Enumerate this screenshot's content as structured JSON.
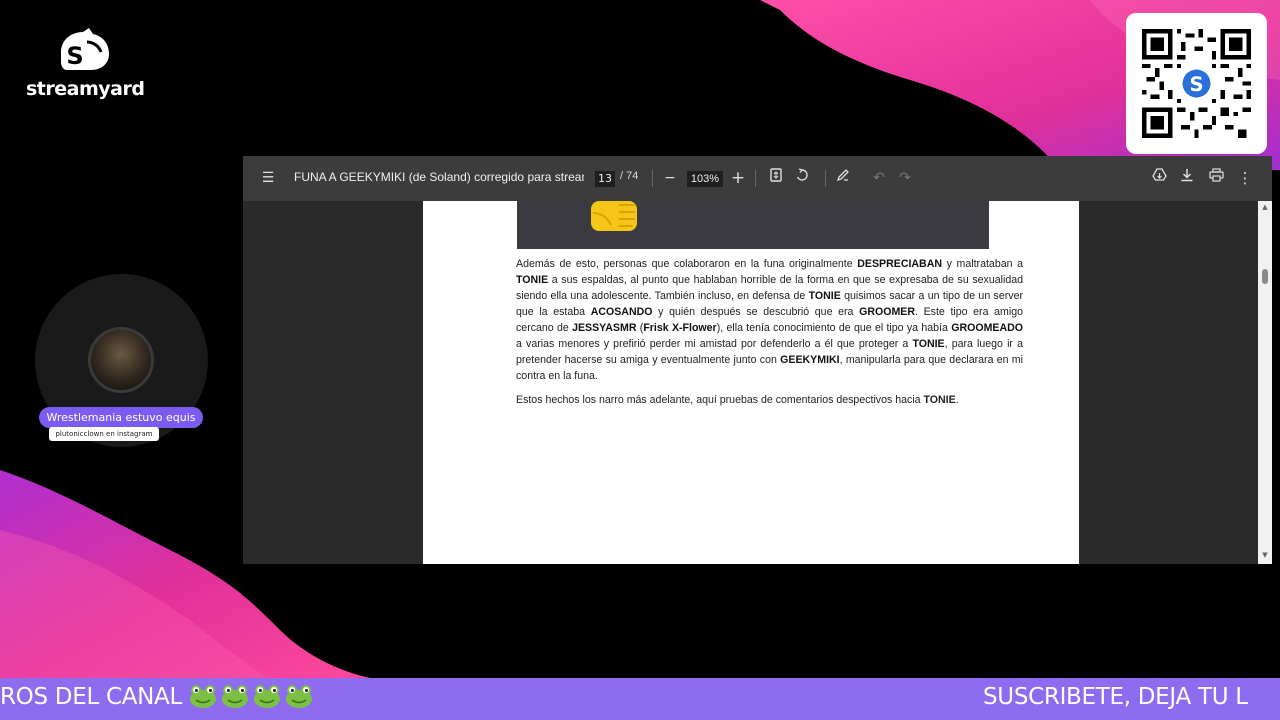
{
  "brand": {
    "wordmark": "streamyard"
  },
  "qr": {
    "icon": "qr-code-icon"
  },
  "participant": {
    "name": "Wrestlemania estuvo equis",
    "subtitle": "plutonicclown en instagram"
  },
  "pdf_viewer": {
    "title": "FUNA A GEEKYMIKI (de Soland) corregido para stream...",
    "page_current": "13",
    "page_total": "/ 74",
    "zoom": "103%",
    "toolbar_icons": [
      "menu-icon",
      "zoom-out-icon",
      "zoom-in-icon",
      "fit-page-icon",
      "rotate-icon",
      "annotate-icon",
      "undo-icon",
      "redo-icon",
      "save-to-drive-icon",
      "download-icon",
      "print-icon",
      "more-options-icon"
    ],
    "paragraph1": [
      {
        "t": "Además de esto, personas que colaboraron en la funa originalmente ",
        "b": false
      },
      {
        "t": "DESPRECIABAN",
        "b": true
      },
      {
        "t": " y maltrataban a ",
        "b": false
      },
      {
        "t": "TONIE",
        "b": true
      },
      {
        "t": " a sus espaldas, al punto que hablaban horrible de la forma en que se expresaba de su sexualidad siendo ella una adolescente. También incluso, en defensa de ",
        "b": false
      },
      {
        "t": "TONIE",
        "b": true
      },
      {
        "t": " quisimos sacar a un tipo de un server que la estaba ",
        "b": false
      },
      {
        "t": "ACOSANDO",
        "b": true
      },
      {
        "t": " y quién después se descubrió que era ",
        "b": false
      },
      {
        "t": "GROOMER",
        "b": true
      },
      {
        "t": ". Este tipo era amigo cercano de ",
        "b": false
      },
      {
        "t": "JESSYASMR",
        "b": true
      },
      {
        "t": " (",
        "b": false
      },
      {
        "t": "Frisk X-Flower",
        "b": true
      },
      {
        "t": "), ella tenía conocimiento de que el tipo ya había ",
        "b": false
      },
      {
        "t": "GROOMEADO",
        "b": true
      },
      {
        "t": " a varias menores y prefirió perder mi amistad por defenderlo a él que proteger a ",
        "b": false
      },
      {
        "t": "TONIE",
        "b": true
      },
      {
        "t": ", para luego ir a pretender hacerse su amiga y eventualmente junto con ",
        "b": false
      },
      {
        "t": "GEEKYMIKI",
        "b": true
      },
      {
        "t": ", manipularla para que declarara en mi contra en la funa.",
        "b": false
      }
    ],
    "paragraph2": [
      {
        "t": "Estos hechos los narro más adelante, aquí pruebas de comentarios despectivos hacia ",
        "b": false
      },
      {
        "t": "TONIE",
        "b": true
      },
      {
        "t": ".",
        "b": false
      }
    ]
  },
  "ticker": {
    "left_text": "ROS DEL CANAL",
    "emoji_icon": "frog-icon",
    "emoji_count": 4,
    "right_text": "SUSCRIBETE, DEJA TU L"
  },
  "colors": {
    "ticker_bg": "#8e6cf0",
    "name_tag_bg": "#7b5cf0",
    "wave_pink": "#e0309a",
    "wave_purple": "#9b2fc9"
  }
}
